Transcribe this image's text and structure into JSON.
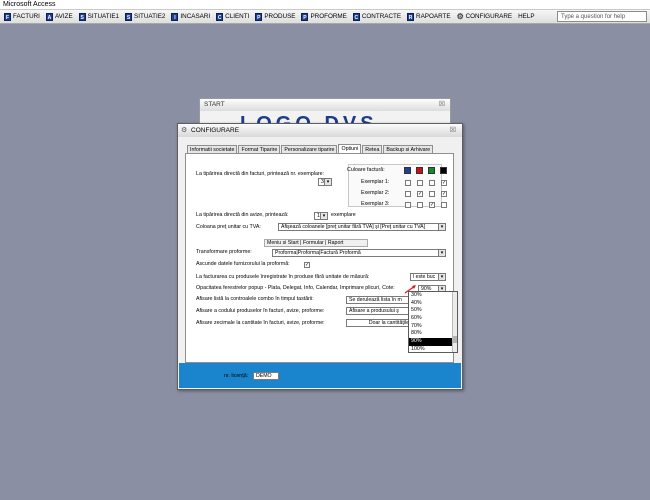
{
  "window_title": "Microsoft Access",
  "menu": [
    {
      "label": "FACTURI",
      "icon": "facturi-icon"
    },
    {
      "label": "AVIZE",
      "icon": "avize-icon"
    },
    {
      "label": "SITUATIE1",
      "icon": "situatie1-icon"
    },
    {
      "label": "SITUATIE2",
      "icon": "situatie2-icon"
    },
    {
      "label": "INCASARI",
      "icon": "incasari-icon"
    },
    {
      "label": "CLIENTI",
      "icon": "clienti-icon"
    },
    {
      "label": "PRODUSE",
      "icon": "produse-icon"
    },
    {
      "label": "PROFORME",
      "icon": "proforme-icon"
    },
    {
      "label": "CONTRACTE",
      "icon": "contracte-icon"
    },
    {
      "label": "RAPOARTE",
      "icon": "rapoarte-icon"
    },
    {
      "label": "CONFIGURARE",
      "icon": "gear-icon"
    },
    {
      "label": "HELP",
      "icon": ""
    }
  ],
  "help_placeholder": "Type a question for help",
  "start_window": {
    "title": "START",
    "logo_text": "LOGO DVS",
    "close": "☒"
  },
  "config": {
    "title": "CONFIGURARE",
    "close": "☒",
    "tabs": [
      "Informatii societate",
      "Format Tiparire",
      "Personalizare tiparire",
      "Optiuni",
      "Retea",
      "Backup si Arhivare"
    ],
    "active_tab": "Optiuni",
    "invoice_copies_label": "La tipărirea directă din facturi, printează nr. exemplare:",
    "invoice_copies_value": "3",
    "invoice_color_label": "Culoare factură:",
    "copies_rows": [
      "Exemplar 1:",
      "Exemplar 2:",
      "Exemplar 3:"
    ],
    "swatch_colors": [
      "#1f3f9a",
      "#d01010",
      "#118a2a",
      "#000000"
    ],
    "copies_checks": [
      [
        false,
        false,
        false,
        true
      ],
      [
        false,
        true,
        false,
        true
      ],
      [
        false,
        false,
        true,
        false
      ]
    ],
    "notice_copies_label": "La tipărirea directă din avize, printează:",
    "notice_copies_value": "1",
    "notice_copies_suffix": "exemplare",
    "vat_label": "Coloana preţ unitar cu TVA:",
    "vat_value": "Afişează coloanele [preţ unitar fără TVA] şi [Preţ unitar cu TVA]",
    "menu_start_text": "Meniu si Start | Formular | Raport",
    "transform_label": "Transformare proforme:",
    "transform_value": "Proforma|Proforma|Factură Proformă",
    "hide_supplier_label": "Ascunde datele furnizorului la proformă:",
    "hide_supplier_checked": "✓",
    "billing_label": "La facturarea cu produsele înregistrate în produse fără unitate de măsură:",
    "billing_value": "l este buc",
    "opacity_label": "Opacitatea ferestrelor popup - Plata, Delegat, Info, Calendar, Imprimare plicuri, Cote:",
    "opacity_value": "90%",
    "combo_list_label": "Afisare listă la controalele combo în timpul tastării:",
    "combo_list_value": "Se derulează lista în m",
    "product_code_label": "Afisare a codului produselor în facturi, avize, proforme:",
    "product_code_value": "Afisare a produsului ş",
    "decimals_label": "Afisare zecimale la cantitate în facturi, avize, proforme:",
    "decimals_value": "Doar la cantităţile",
    "license_label": "nr. licenţă:",
    "license_value": "DEMO"
  },
  "opacity_options": [
    "30%",
    "40%",
    "50%",
    "60%",
    "70%",
    "80%",
    "90%",
    "100%"
  ],
  "opacity_selected": "90%",
  "annotation_color": "#e0161a"
}
